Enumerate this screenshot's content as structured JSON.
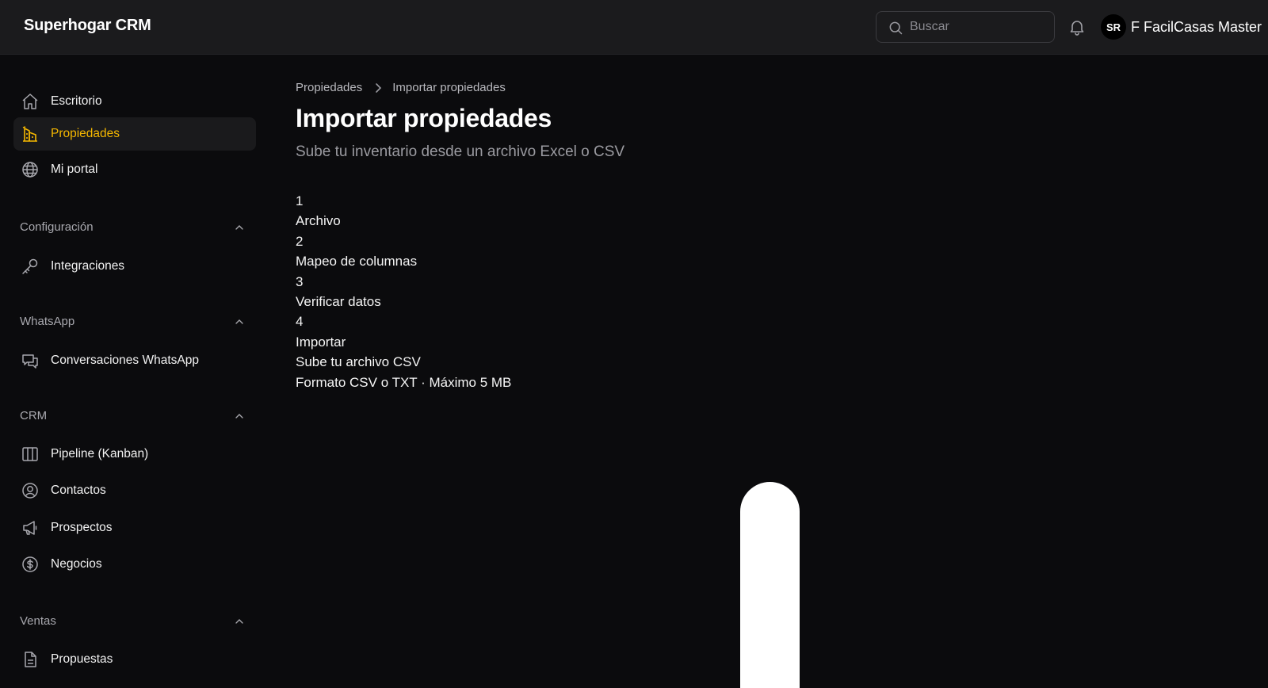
{
  "app": {
    "brand": "Superhogar CRM"
  },
  "header": {
    "search_placeholder": "Buscar",
    "user_initials": "SR",
    "user_name": "F FacilCasas Master"
  },
  "sidebar": {
    "main_items": [
      {
        "label": "Escritorio",
        "icon": "home-icon"
      },
      {
        "label": "Propiedades",
        "icon": "building-icon",
        "active": true
      },
      {
        "label": "Mi portal",
        "icon": "globe-icon"
      }
    ],
    "sections": [
      {
        "title": "Configuración",
        "items": [
          {
            "label": "Integraciones",
            "icon": "key-icon"
          }
        ]
      },
      {
        "title": "WhatsApp",
        "items": [
          {
            "label": "Conversaciones WhatsApp",
            "icon": "chat-icon"
          }
        ]
      },
      {
        "title": "CRM",
        "items": [
          {
            "label": "Pipeline (Kanban)",
            "icon": "kanban-icon"
          },
          {
            "label": "Contactos",
            "icon": "user-circle-icon"
          },
          {
            "label": "Prospectos",
            "icon": "megaphone-icon"
          },
          {
            "label": "Negocios",
            "icon": "dollar-icon"
          }
        ]
      },
      {
        "title": "Ventas",
        "items": [
          {
            "label": "Propuestas",
            "icon": "document-icon"
          }
        ]
      }
    ]
  },
  "main": {
    "breadcrumb": [
      "Propiedades",
      "Importar propiedades"
    ],
    "title": "Importar propiedades",
    "subtitle": "Sube tu inventario desde un archivo Excel o CSV",
    "steps": [
      {
        "number": "1",
        "label": "Archivo"
      },
      {
        "number": "2",
        "label": "Mapeo de columnas"
      },
      {
        "number": "3",
        "label": "Verificar datos"
      },
      {
        "number": "4",
        "label": "Importar"
      }
    ],
    "upload_title": "Sube tu archivo CSV",
    "upload_hint": "Formato CSV o TXT · Máximo 5 MB"
  },
  "colors": {
    "accent": "#f5b700",
    "background": "#0b0b0d",
    "topbar": "#1b1b1d"
  }
}
